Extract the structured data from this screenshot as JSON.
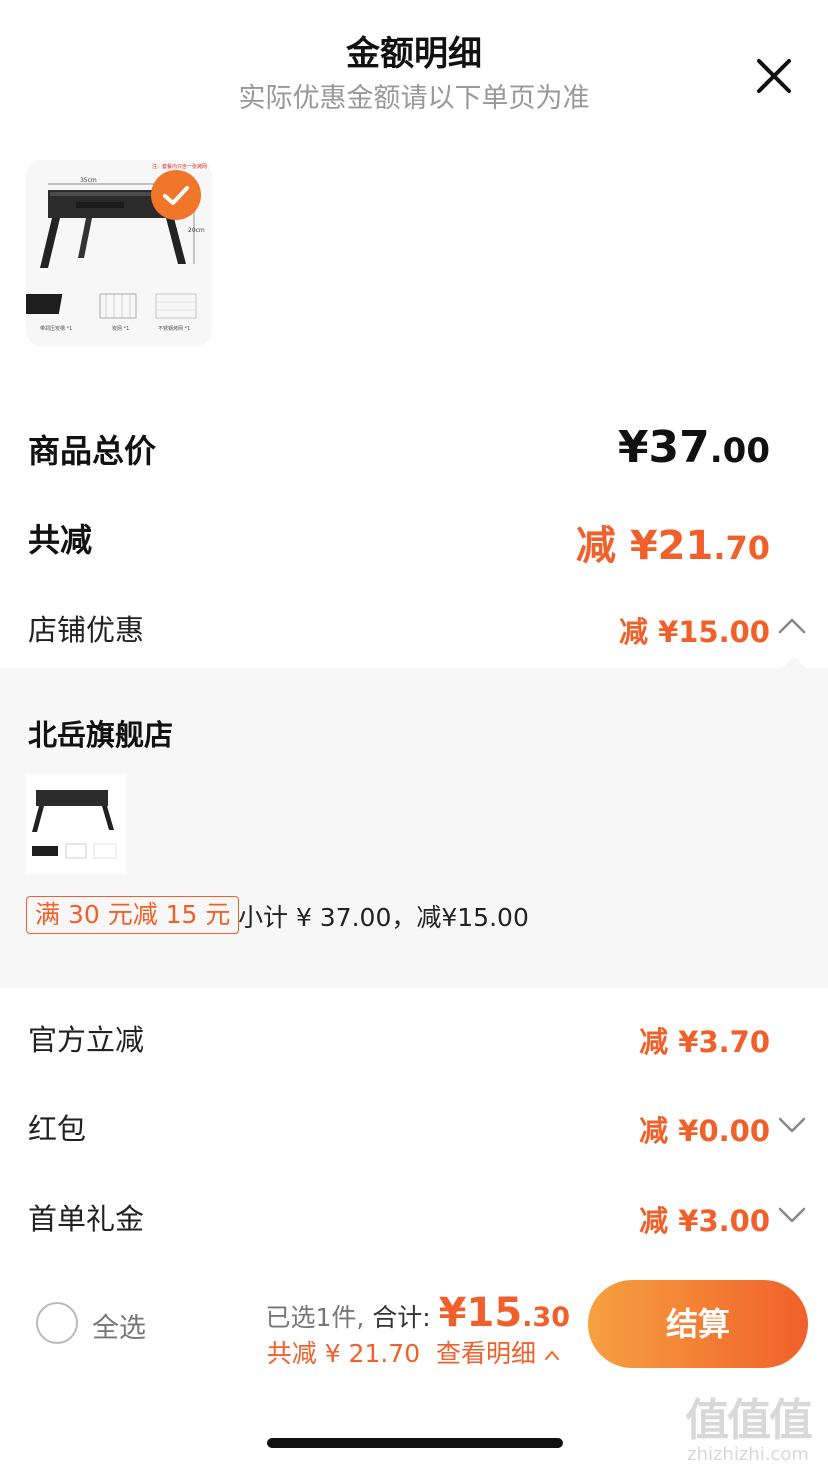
{
  "header": {
    "title": "金额明细",
    "subtitle": "实际优惠金额请以下单页为准"
  },
  "product": {
    "image_labels": {
      "note": "注：套餐内只含一张烤网",
      "width": "35cm",
      "height": "20cm",
      "item1": "带凋压炭槽 *1",
      "item2": "炭网 *1",
      "item3": "不锈钢烤网 *1"
    }
  },
  "summary": {
    "total_label": "商品总价",
    "total_price_main": "¥37",
    "total_price_cents": ".00",
    "reduce_label": "共减",
    "reduce_main": "减 ¥21",
    "reduce_cents": ".70"
  },
  "discounts": {
    "store": {
      "label": "店铺优惠",
      "amount": "减 ¥15.00"
    },
    "official": {
      "label": "官方立减",
      "amount": "减 ¥3.70"
    },
    "redpacket": {
      "label": "红包",
      "amount": "减 ¥0.00"
    },
    "first_order": {
      "label": "首单礼金",
      "amount": "减 ¥3.00"
    }
  },
  "store_panel": {
    "store_name": "北岳旗舰店",
    "promo_tag": "满 30 元减 15 元",
    "subtotal": "小计 ¥ 37.00，减¥15.00"
  },
  "footer": {
    "select_all": "全选",
    "selected_text": "已选1件,",
    "total_label": "合计:",
    "sum_main": "¥15",
    "sum_cents": ".30",
    "reduce_text": "共减 ¥ 21.70",
    "detail_text": "查看明细",
    "checkout": "结算"
  },
  "watermark": {
    "logo": "值值值",
    "url": "zhizhizhi.com"
  },
  "colors": {
    "accent": "#f0602a",
    "gradient_start": "#f6a140",
    "panel_bg": "#f7f7f7"
  }
}
